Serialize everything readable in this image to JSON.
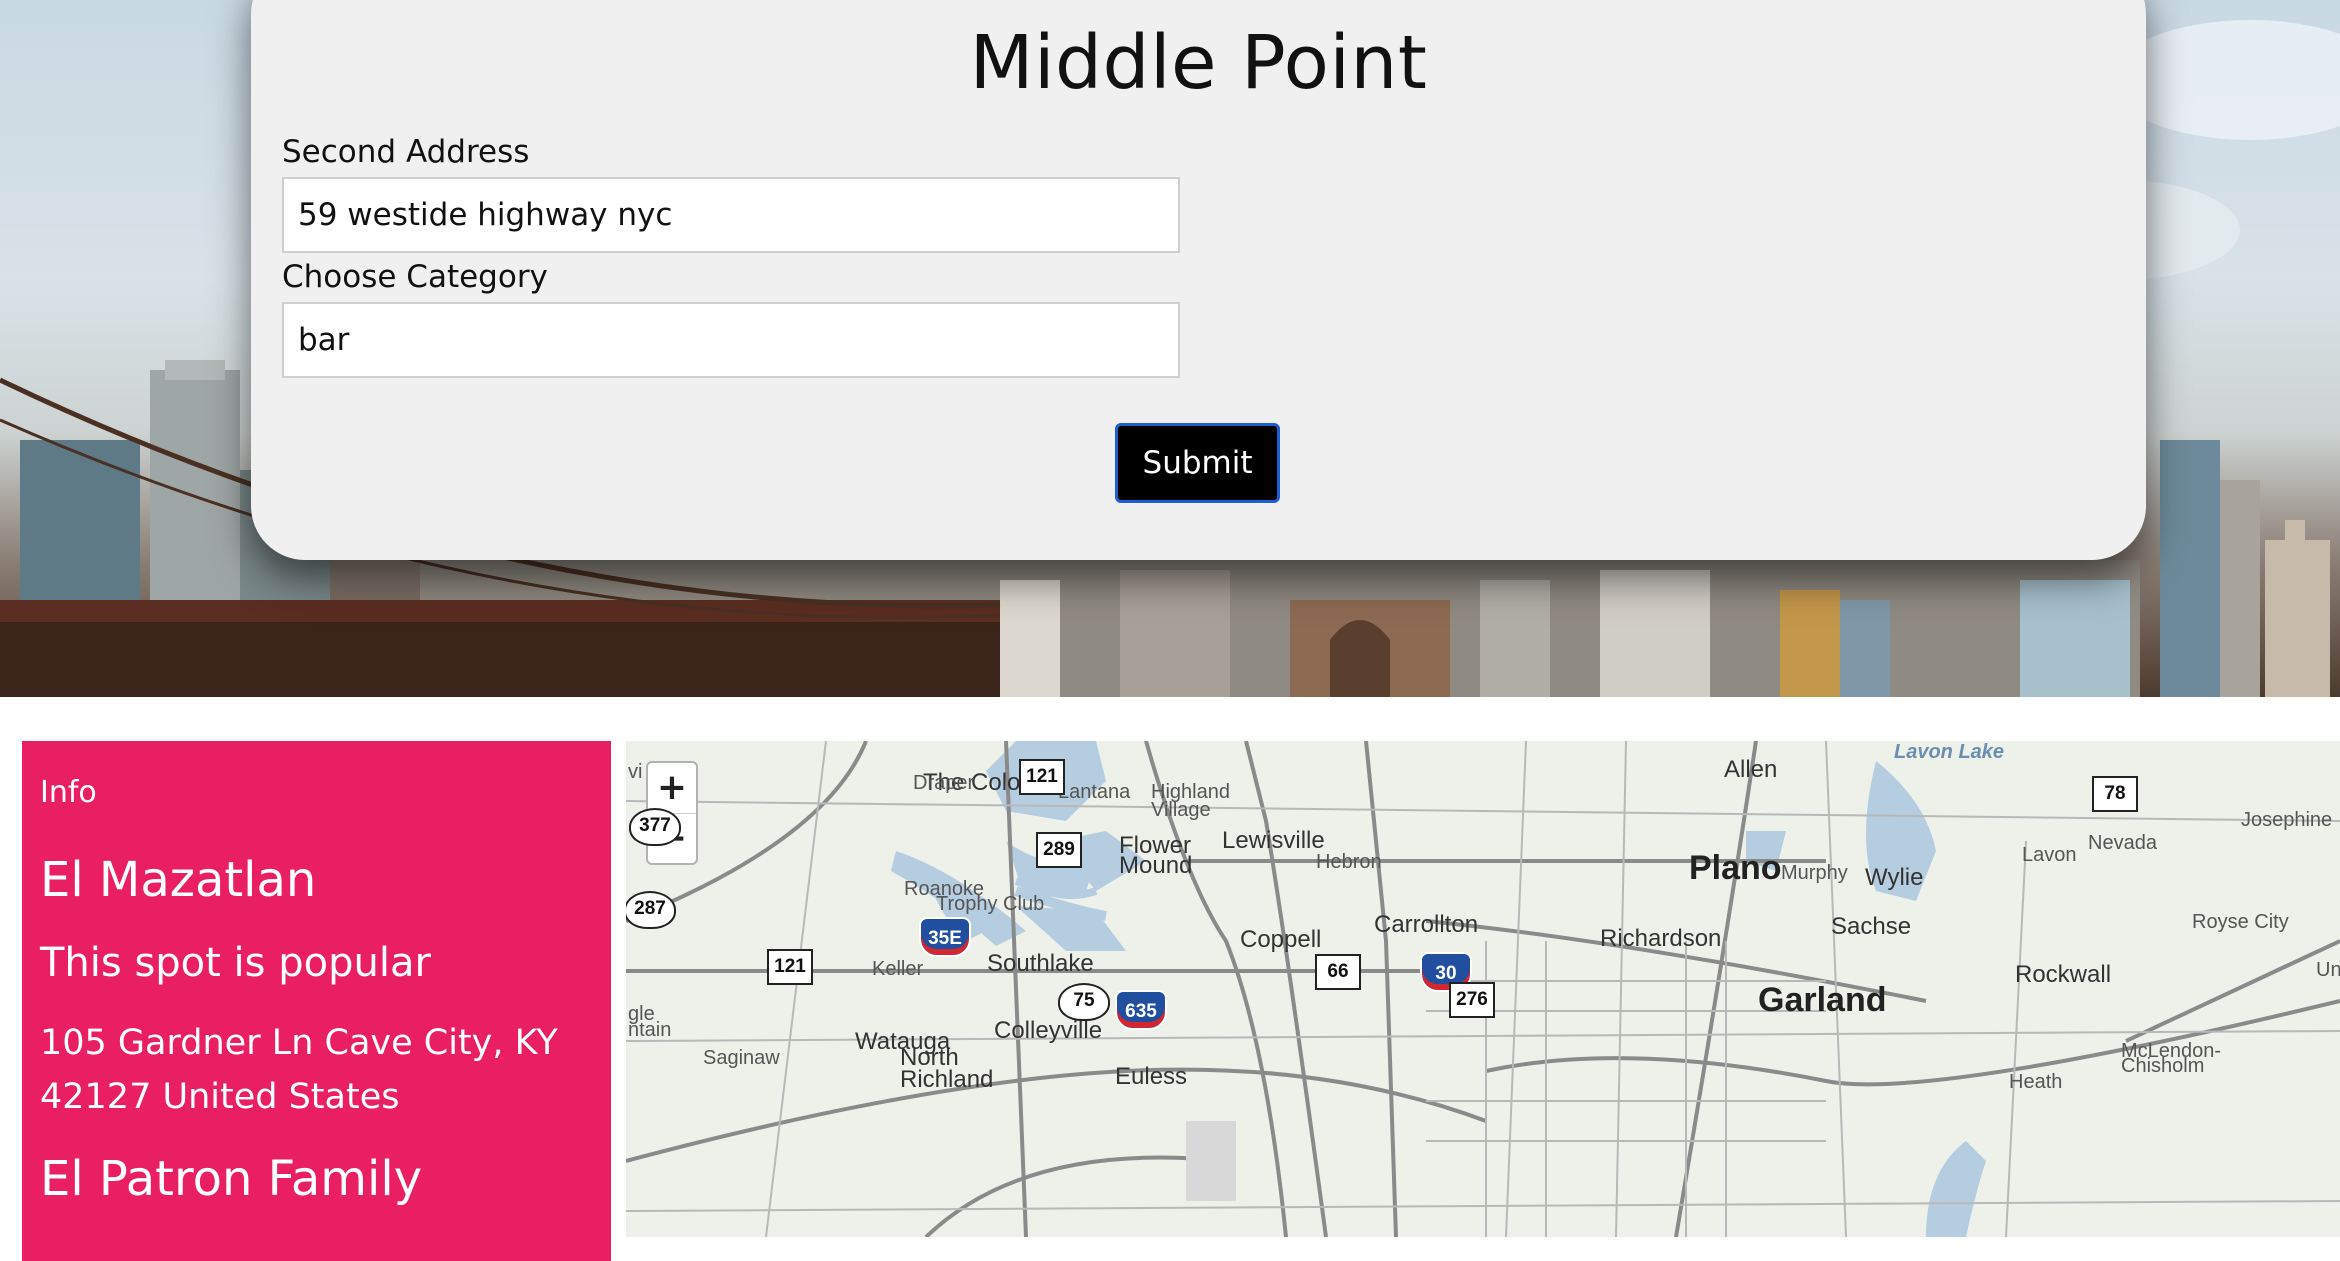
{
  "app": {
    "title": "Middle Point"
  },
  "form": {
    "second_address_label": "Second Address",
    "second_address_value": "59 westide highway nyc",
    "category_label": "Choose Category",
    "category_value": "bar",
    "submit_label": "Submit"
  },
  "info": {
    "heading": "Info",
    "places": [
      {
        "name": "El Mazatlan",
        "popularity": "This spot is popular",
        "address": "105 Gardner Ln Cave City, KY 42127 United States"
      },
      {
        "name": "El Patron Family"
      }
    ]
  },
  "map": {
    "zoom_in_label": "+",
    "zoom_out_label": "−",
    "labels": {
      "lavon_lake": "Lavon Lake",
      "allen": "Allen",
      "the_colony": "The Colony",
      "draper": "Draper",
      "lantana": "Lantana",
      "highland_village": "Highland Village",
      "lewisville": "Lewisville",
      "flower_mound": "Flower Mound",
      "hebron": "Hebron",
      "plano": "Plano",
      "murphy": "Murphy",
      "wylie": "Wylie",
      "lavon": "Lavon",
      "nevada": "Nevada",
      "josephine": "Josephine",
      "roanoke": "Roanoke",
      "trophy_club": "Trophy Club",
      "carrollton": "Carrollton",
      "coppell": "Coppell",
      "richardson": "Richardson",
      "sachse": "Sachse",
      "royse_city": "Royse City",
      "keller": "Keller",
      "southlake": "Southlake",
      "rockwall": "Rockwall",
      "garland": "Garland",
      "colleyville": "Colleyville",
      "watauga": "Watauga",
      "saginaw": "Saginaw",
      "north_richland": "North Richland",
      "euless": "Euless",
      "mclendon_chisholm": "McLendon-Chisholm",
      "unio": "Uni",
      "gle_ntain": "gle ntain",
      "vi": "vi",
      "heath": "Heath"
    },
    "shields": {
      "r121a": "121",
      "r78": "78",
      "r377": "377",
      "r289": "289",
      "r287": "287",
      "r35e": "35E",
      "r121b": "121",
      "r75": "75",
      "r635": "635",
      "r66": "66",
      "r30": "30",
      "r276": "276"
    }
  }
}
